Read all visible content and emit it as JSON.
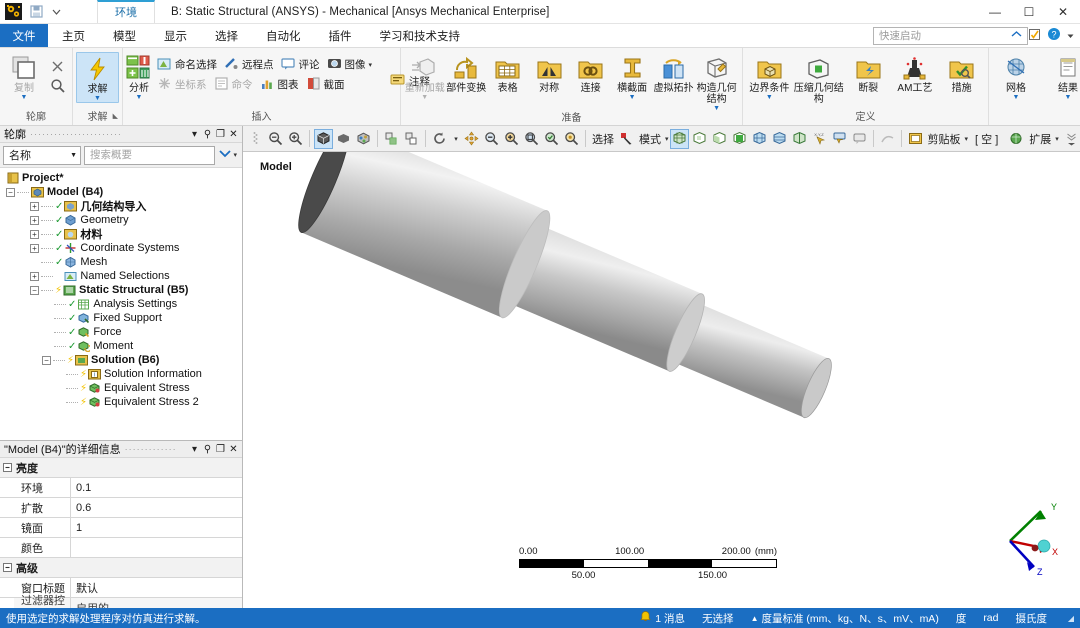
{
  "titlebar": {
    "context_tab": "环境",
    "title": "B: Static Structural (ANSYS) - Mechanical [Ansys Mechanical Enterprise]",
    "minimize": "—",
    "maximize": "☐",
    "close": "✕"
  },
  "menubar": {
    "file": "文件",
    "items": [
      "主页",
      "模型",
      "显示",
      "选择",
      "自动化",
      "插件",
      "学习和技术支持"
    ],
    "selected": "模型",
    "quick_launch_placeholder": "快速启动"
  },
  "ribbon": {
    "groups": [
      {
        "label": "轮廓",
        "big": [
          {
            "label": "复制",
            "icon": "duplicate-icon",
            "disabled": true,
            "dropdown": true
          }
        ],
        "small": [
          {
            "label": "",
            "icon": "close-x-icon"
          },
          {
            "label": "",
            "icon": "search-icon"
          }
        ]
      },
      {
        "label": "求解",
        "dialog_launcher": true,
        "big": [
          {
            "label": "求解",
            "icon": "solve-lightning-icon",
            "active": true,
            "dropdown": true
          }
        ]
      },
      {
        "label": "插入",
        "big": [
          {
            "label": "分析",
            "icon": "analysis-icon",
            "dropdown": true
          }
        ],
        "small": [
          {
            "label": "命名选择",
            "icon": "named-selection-icon"
          },
          {
            "label": "远程点",
            "icon": "remote-point-icon"
          },
          {
            "label": "评论",
            "icon": "comment-icon"
          },
          {
            "label": "图像",
            "icon": "image-icon",
            "dropdown": true
          },
          {
            "label": "坐标系",
            "icon": "coordinate-system-icon",
            "disabled": true
          },
          {
            "label": "命令",
            "icon": "command-icon",
            "disabled": true
          },
          {
            "label": "图表",
            "icon": "chart-icon"
          },
          {
            "label": "截面",
            "icon": "section-icon"
          },
          {
            "label": "注释",
            "icon": "annotation-icon"
          }
        ]
      },
      {
        "label": "准备",
        "big": [
          {
            "label": "重新加载",
            "icon": "reload-icon",
            "disabled": true,
            "dropdown": true
          },
          {
            "label": "部件变换",
            "icon": "part-transform-icon"
          },
          {
            "label": "表格",
            "icon": "table-icon"
          },
          {
            "label": "对称",
            "icon": "symmetry-icon"
          },
          {
            "label": "连接",
            "icon": "connection-icon"
          },
          {
            "label": "横截面",
            "icon": "cross-section-icon",
            "dropdown": true
          },
          {
            "label": "虚拟拓扑",
            "icon": "virtual-topology-icon"
          },
          {
            "label": "构造几何结构",
            "icon": "construction-geometry-icon",
            "dropdown": true
          }
        ]
      },
      {
        "label": "定义",
        "big": [
          {
            "label": "边界条件",
            "icon": "boundary-condition-icon",
            "dropdown": true
          },
          {
            "label": "压缩几何结构",
            "icon": "compress-geometry-icon"
          },
          {
            "label": "断裂",
            "icon": "fracture-icon"
          },
          {
            "label": "AM工艺",
            "icon": "am-process-icon"
          },
          {
            "label": "措施",
            "icon": "measures-icon"
          }
        ]
      },
      {
        "label": "",
        "big": [
          {
            "label": "网格",
            "icon": "mesh-icon",
            "dropdown": true
          },
          {
            "label": "结果",
            "icon": "results-icon",
            "dropdown": true
          }
        ]
      }
    ]
  },
  "outline_panel": {
    "title": "轮廓",
    "name_combo": "名称",
    "search_placeholder": "搜索概要",
    "tree": [
      {
        "label": "Project*",
        "depth": 0,
        "bold": true,
        "icon": "project-icon",
        "expander": ""
      },
      {
        "label": "Model (B4)",
        "depth": 0,
        "bold": true,
        "icon": "model-icon",
        "expander": "−"
      },
      {
        "label": "几何结构导入",
        "depth": 1,
        "bold": true,
        "icon": "geometry-import-icon",
        "expander": "+",
        "check": true
      },
      {
        "label": "Geometry",
        "depth": 1,
        "bold": false,
        "icon": "geometry-icon",
        "expander": "+",
        "check": true
      },
      {
        "label": "材料",
        "depth": 1,
        "bold": true,
        "icon": "materials-icon",
        "expander": "+",
        "check": true
      },
      {
        "label": "Coordinate Systems",
        "depth": 1,
        "bold": false,
        "icon": "coordinate-systems-icon",
        "expander": "+",
        "check": true
      },
      {
        "label": "Mesh",
        "depth": 1,
        "bold": false,
        "icon": "mesh-tree-icon",
        "expander": "",
        "check": true
      },
      {
        "label": "Named Selections",
        "depth": 1,
        "bold": false,
        "icon": "named-selections-icon",
        "expander": "+",
        "check": false
      },
      {
        "label": "Static Structural (B5)",
        "depth": 1,
        "bold": true,
        "icon": "static-structural-icon",
        "expander": "−",
        "bolt": true
      },
      {
        "label": "Analysis Settings",
        "depth": 2,
        "bold": false,
        "icon": "analysis-settings-icon",
        "expander": "",
        "check": true
      },
      {
        "label": "Fixed Support",
        "depth": 2,
        "bold": false,
        "icon": "fixed-support-icon",
        "expander": "",
        "check": true
      },
      {
        "label": "Force",
        "depth": 2,
        "bold": false,
        "icon": "force-icon",
        "expander": "",
        "check": true
      },
      {
        "label": "Moment",
        "depth": 2,
        "bold": false,
        "icon": "moment-icon",
        "expander": "",
        "check": true
      },
      {
        "label": "Solution (B6)",
        "depth": 2,
        "bold": true,
        "icon": "solution-icon",
        "expander": "−",
        "bolt": true
      },
      {
        "label": "Solution Information",
        "depth": 3,
        "bold": false,
        "icon": "solution-information-icon",
        "expander": "",
        "bolt": true
      },
      {
        "label": "Equivalent Stress",
        "depth": 3,
        "bold": false,
        "icon": "equivalent-stress-icon",
        "expander": "",
        "bolt": true
      },
      {
        "label": "Equivalent Stress 2",
        "depth": 3,
        "bold": false,
        "icon": "equivalent-stress-icon",
        "expander": "",
        "bolt": true
      }
    ]
  },
  "details_panel": {
    "title": "\"Model (B4)\"的详细信息",
    "sections": [
      {
        "name": "亮度",
        "rows": [
          {
            "key": "环境",
            "value": "0.1"
          },
          {
            "key": "扩散",
            "value": "0.6"
          },
          {
            "key": "镜面",
            "value": "1"
          },
          {
            "key": "颜色",
            "value": ""
          }
        ]
      },
      {
        "name": "高级",
        "rows": [
          {
            "key": "窗口标题",
            "value": "默认"
          },
          {
            "key": "过滤器控制",
            "value": "启用的",
            "highlight": true
          }
        ]
      }
    ]
  },
  "graphics_toolbar": {
    "left_icons": [
      "zoom-out-icon",
      "zoom-in-icon",
      "shaded-exterior-edges-icon",
      "shaded-exterior-icon",
      "wireframe-icon",
      "show-mesh-icon",
      "hide-mesh-icon",
      "rotate-icon",
      "pan-icon",
      "zoom-fit-icon",
      "zoom-box-icon",
      "zoom-region-icon",
      "zoom-to-fit-icon",
      "magnify-icon"
    ],
    "select_label": "选择",
    "mode_label": "模式",
    "right_icons": [
      "select-mode-icon",
      "vertex-select-icon",
      "edge-select-icon",
      "face-select-icon",
      "body-select-icon",
      "box-select-icon",
      "box-volume-select-icon",
      "lasso-select-icon",
      "xyz-probe-icon",
      "probe-label-icon",
      "annotation-balloon-icon",
      "curve-icon"
    ],
    "clipboard_label": "剪贴板",
    "empty_label": "[ 空 ]",
    "extend_label": "扩展"
  },
  "viewport": {
    "label": "Model",
    "triad": {
      "x": "X",
      "y": "Y",
      "z": "Z"
    },
    "scalebar": {
      "ticks_top": [
        "0.00",
        "100.00",
        "200.00"
      ],
      "unit": "(mm)",
      "ticks_bottom": [
        "50.00",
        "150.00"
      ]
    }
  },
  "statusbar": {
    "message": "使用选定的求解处理程序对仿真进行求解。",
    "messages_count": "1 消息",
    "selection": "无选择",
    "unit_system": "度量标准 (mm、kg、N、s、mV、mA)",
    "angle": "度",
    "rotation": "rad",
    "temperature": "摄氏度"
  },
  "colors": {
    "accent": "#1b6ec2",
    "ribbon_bg": "#f6f6f6",
    "viewport_bg": "#ffffff",
    "tree_check": "#1f9a34",
    "axis_x": "#c00000",
    "axis_y": "#008000",
    "axis_z": "#0000c0"
  }
}
